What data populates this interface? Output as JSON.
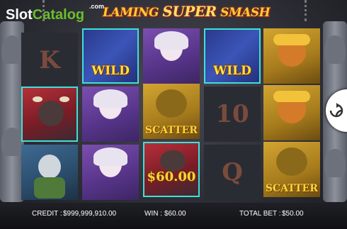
{
  "logo": {
    "part1": "Slot",
    "part2": "Catalog",
    "suffix": ".com"
  },
  "game": {
    "title_left": "LAMING ",
    "title_mid": "SUPER",
    "title_right": " SMASH"
  },
  "reels": {
    "r1": {
      "c1_letter": "K",
      "c2": "bull",
      "c3": "troll"
    },
    "r2": {
      "c1_label": "WILD",
      "c2": "princess",
      "c3": "princess"
    },
    "r3": {
      "c1": "princess",
      "c2_label": "SCATTER",
      "c3_value": "$60.00"
    },
    "r4": {
      "c1_label": "WILD",
      "c2_letter": "10",
      "c3_letter": "Q"
    },
    "r5": {
      "c1": "monkey",
      "c2": "monkey",
      "c3_label": "SCATTER"
    }
  },
  "bar": {
    "credit_label": "CREDIT :",
    "credit_value": "$999,999,910.00",
    "win_label": "WIN :",
    "win_value": "$60.00",
    "total_bet_label": "TOTAL BET :",
    "total_bet_value": "$50.00"
  },
  "colors": {
    "highlight": "#3fe0d8",
    "gold": "#ffd23a"
  },
  "icons": {
    "spin": "spin-arrows-icon"
  }
}
